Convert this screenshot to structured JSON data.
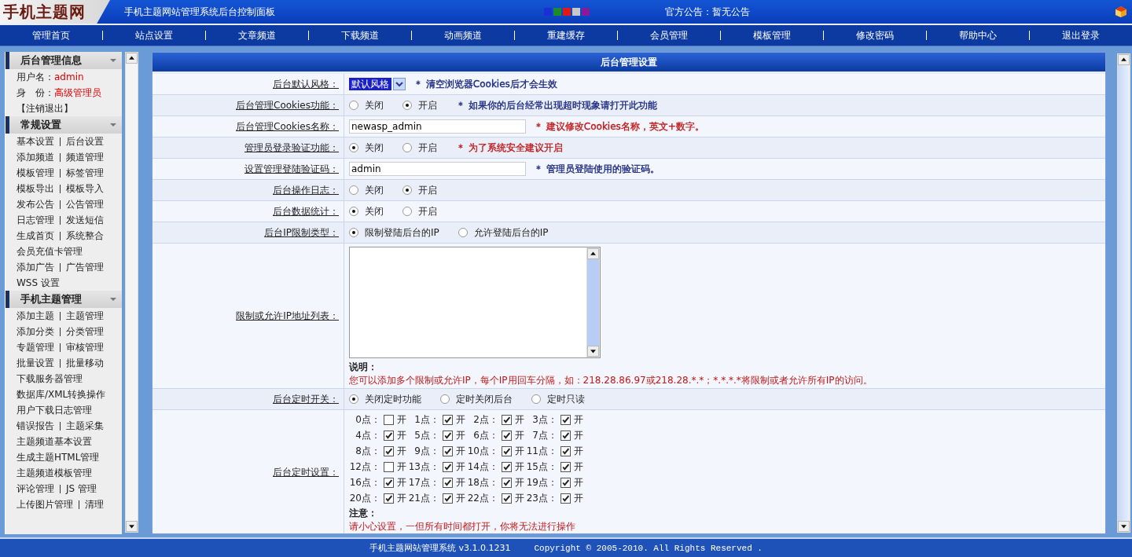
{
  "header": {
    "logo": "手机主题网",
    "title": "手机主题网站管理系统后台控制面板",
    "themes": [
      {
        "color": "#1b2fd6"
      },
      {
        "color": "#1e8a2e"
      },
      {
        "color": "#e01818"
      },
      {
        "color": "#c8c8c8"
      },
      {
        "color": "#8a1a9a"
      }
    ],
    "announcement": "官方公告：暂无公告"
  },
  "nav": [
    "管理首页",
    "站点设置",
    "文章频道",
    "下载频道",
    "动画频道",
    "重建缓存",
    "会员管理",
    "模板管理",
    "修改密码",
    "帮助中心",
    "退出登录"
  ],
  "sidebar": {
    "sections": [
      {
        "title": "后台管理信息",
        "kind": "info",
        "lines": [
          {
            "label": "用户名：",
            "value": "admin"
          },
          {
            "label": "身　份：",
            "value": "高级管理员"
          }
        ],
        "logout": "【注销退出】"
      },
      {
        "title": "常规设置",
        "kind": "links",
        "items": [
          [
            "基本设置",
            "后台设置"
          ],
          [
            "添加频道",
            "频道管理"
          ],
          [
            "模板管理",
            "标签管理"
          ],
          [
            "模板导出",
            "模板导入"
          ],
          [
            "发布公告",
            "公告管理"
          ],
          [
            "日志管理",
            "发送短信"
          ],
          [
            "生成首页",
            "系统整合"
          ],
          [
            "会员充值卡管理"
          ],
          [
            "添加广告",
            "广告管理"
          ],
          [
            "WSS 设置"
          ]
        ]
      },
      {
        "title": "手机主题管理",
        "kind": "links",
        "items": [
          [
            "添加主题",
            "主题管理"
          ],
          [
            "添加分类",
            "分类管理"
          ],
          [
            "专题管理",
            "审核管理"
          ],
          [
            "批量设置",
            "批量移动"
          ],
          [
            "下载服务器管理"
          ],
          [
            "数据库/XML转换操作"
          ],
          [
            "用户下载日志管理"
          ],
          [
            "错误报告",
            "主题采集"
          ],
          [
            "主题频道基本设置"
          ],
          [
            "生成主题HTML管理"
          ],
          [
            "主题频道模板管理"
          ],
          [
            "评论管理",
            "JS 管理"
          ],
          [
            "上传图片管理",
            "清理"
          ]
        ]
      }
    ]
  },
  "panel": {
    "title": "后台管理设置",
    "rows": [
      {
        "kind": "select",
        "label": "后台默认风格：",
        "value": "默认风格",
        "note": "＊ 清空浏览器Cookies后才会生效",
        "color": "#1c2a80"
      },
      {
        "kind": "radio",
        "label": "后台管理Cookies功能：",
        "options": [
          {
            "label": "关闭",
            "selected": false
          },
          {
            "label": "开启",
            "selected": true
          }
        ],
        "note": "＊ 如果你的后台经常出现超时现象请打开此功能",
        "color": "#1c2a80"
      },
      {
        "kind": "text",
        "label": "后台管理Cookies名称：",
        "value": "newasp_admin",
        "note": "＊ 建议修改Cookies名称，英文+数字。",
        "color": "#c01818"
      },
      {
        "kind": "radio",
        "label": "管理员登录验证功能：",
        "options": [
          {
            "label": "关闭",
            "selected": true
          },
          {
            "label": "开启",
            "selected": false
          }
        ],
        "note": "＊ 为了系统安全建议开启",
        "color": "#c01818"
      },
      {
        "kind": "text",
        "label": "设置管理登陆验证码：",
        "value": "admin",
        "note": "＊ 管理员登陆使用的验证码。",
        "color": "#1c2a80"
      },
      {
        "kind": "radio",
        "label": "后台操作日志：",
        "options": [
          {
            "label": "关闭",
            "selected": false
          },
          {
            "label": "开启",
            "selected": true
          }
        ]
      },
      {
        "kind": "radio",
        "label": "后台数据统计：",
        "options": [
          {
            "label": "关闭",
            "selected": true
          },
          {
            "label": "开启",
            "selected": false
          }
        ]
      },
      {
        "kind": "radio",
        "label": "后台IP限制类型：",
        "options": [
          {
            "label": "限制登陆后台的IP",
            "selected": true
          },
          {
            "label": "允许登陆后台的IP",
            "selected": false
          }
        ]
      },
      {
        "kind": "textarea",
        "label": "限制或允许IP地址列表：",
        "caption": "说明：",
        "explanation": "您可以添加多个限制或允许IP，每个IP用回车分隔，如：218.28.86.97或218.28.*.*；*.*.*.*将限制或者允许所有IP的访问。"
      },
      {
        "kind": "radio",
        "label": "后台定时开关：",
        "options": [
          {
            "label": "关闭定时功能",
            "selected": true
          },
          {
            "label": "定时关闭后台",
            "selected": false
          },
          {
            "label": "定时只读",
            "selected": false
          }
        ]
      },
      {
        "kind": "hours",
        "label": "后台定时设置：",
        "hours": [
          {
            "label": "0点：",
            "checked": false,
            "text": "开"
          },
          {
            "label": "1点：",
            "checked": true,
            "text": "开"
          },
          {
            "label": "2点：",
            "checked": true,
            "text": "开"
          },
          {
            "label": "3点：",
            "checked": true,
            "text": "开"
          },
          {
            "label": "4点：",
            "checked": true,
            "text": "开"
          },
          {
            "label": "5点：",
            "checked": true,
            "text": "开"
          },
          {
            "label": "6点：",
            "checked": true,
            "text": "开"
          },
          {
            "label": "7点：",
            "checked": true,
            "text": "开"
          },
          {
            "label": "8点：",
            "checked": true,
            "text": "开"
          },
          {
            "label": "9点：",
            "checked": true,
            "text": "开"
          },
          {
            "label": "10点：",
            "checked": true,
            "text": "开"
          },
          {
            "label": "11点：",
            "checked": true,
            "text": "开"
          },
          {
            "label": "12点：",
            "checked": false,
            "text": "开"
          },
          {
            "label": "13点：",
            "checked": true,
            "text": "开"
          },
          {
            "label": "14点：",
            "checked": true,
            "text": "开"
          },
          {
            "label": "15点：",
            "checked": true,
            "text": "开"
          },
          {
            "label": "16点：",
            "checked": true,
            "text": "开"
          },
          {
            "label": "17点：",
            "checked": true,
            "text": "开"
          },
          {
            "label": "18点：",
            "checked": true,
            "text": "开"
          },
          {
            "label": "19点：",
            "checked": true,
            "text": "开"
          },
          {
            "label": "20点：",
            "checked": true,
            "text": "开"
          },
          {
            "label": "21点：",
            "checked": true,
            "text": "开"
          },
          {
            "label": "22点：",
            "checked": true,
            "text": "开"
          },
          {
            "label": "23点：",
            "checked": true,
            "text": "开"
          }
        ],
        "caption": "注意：",
        "explanation": "请小心设置，一但所有时间都打开，你将无法进行操作"
      }
    ]
  },
  "footer": {
    "version": "手机主题网站管理系统 v3.1.0.1231",
    "copyright": "Copyright © 2005-2010. All Rights Reserved ."
  }
}
